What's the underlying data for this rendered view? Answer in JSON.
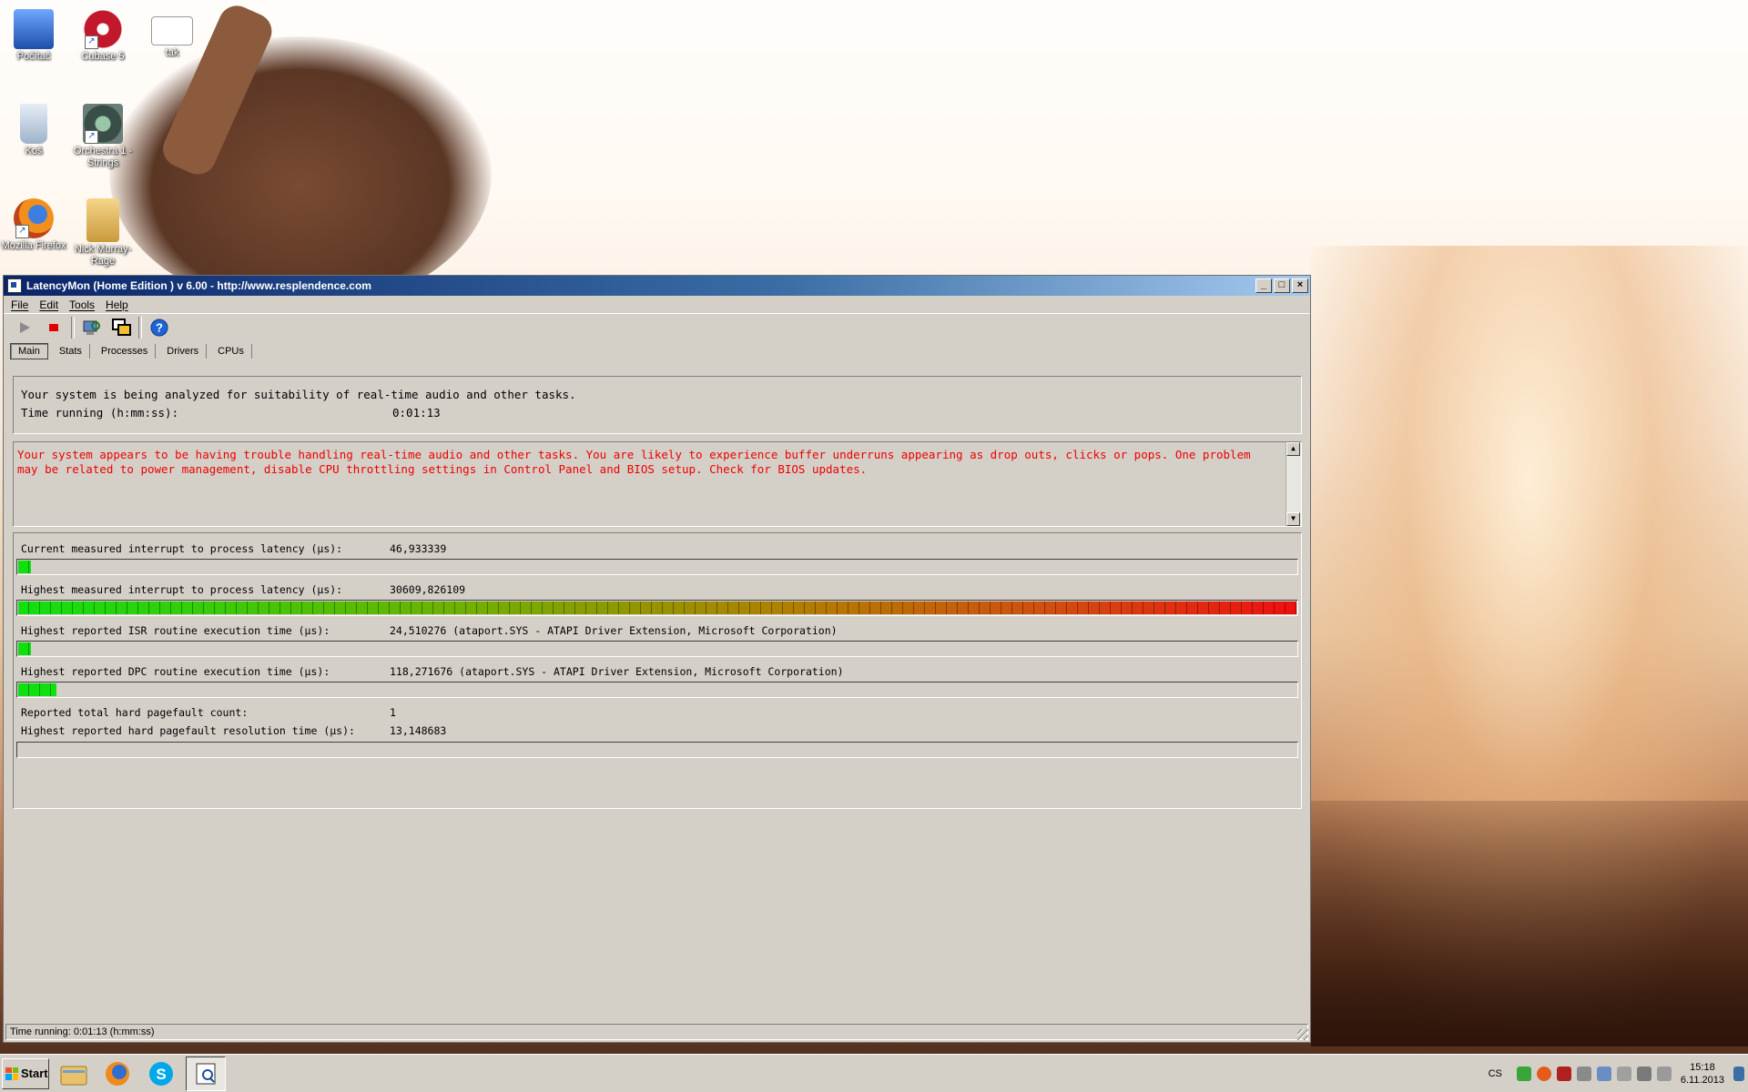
{
  "desktop": {
    "icons": [
      {
        "name": "Počítač"
      },
      {
        "name": "Cubase 5"
      },
      {
        "name": "tak"
      },
      {
        "name": "Koš"
      },
      {
        "name": "Orchestra 1 - Strings"
      },
      {
        "name": "Mozilla Firefox"
      },
      {
        "name": "Nick Murray-Rage"
      }
    ]
  },
  "window": {
    "title": "LatencyMon  (Home Edition )  v 6.00 - http://www.resplendence.com",
    "menu": [
      "File",
      "Edit",
      "Tools",
      "Help"
    ],
    "tabs": [
      "Main",
      "Stats",
      "Processes",
      "Drivers",
      "CPUs"
    ],
    "summary": {
      "line1": "Your system is being analyzed for suitability of real-time audio and other tasks.",
      "time_label": "Time running (h:mm:ss):",
      "time_value": "0:01:13"
    },
    "verdict": "Your system appears to be having trouble handling real-time audio and other tasks. You are likely to experience buffer underruns appearing as drop outs, clicks or pops. One problem may be related to power management, disable CPU throttling settings in Control Panel and BIOS setup. Check for BIOS updates.",
    "metrics": {
      "current_latency": {
        "label": "Current measured interrupt to process latency (µs):",
        "value": "46,933339",
        "level": 0.01
      },
      "highest_latency": {
        "label": "Highest measured interrupt to process latency (µs):",
        "value": "30609,826109",
        "level": 1.0
      },
      "isr": {
        "label": "Highest reported ISR routine execution time (µs):",
        "value": "24,510276  (ataport.SYS - ATAPI Driver Extension, Microsoft Corporation)",
        "level": 0.01
      },
      "dpc": {
        "label": "Highest reported DPC routine execution time (µs):",
        "value": "118,271676  (ataport.SYS - ATAPI Driver Extension, Microsoft Corporation)",
        "level": 0.03
      },
      "pagefault_count": {
        "label": "Reported total hard pagefault count:",
        "value": "1"
      },
      "pagefault_time": {
        "label": "Highest reported hard pagefault resolution time (µs):",
        "value": "13,148683",
        "level": 0.0
      }
    },
    "status_bar": "Time running: 0:01:13  (h:mm:ss)"
  },
  "taskbar": {
    "start_label": "Start",
    "apps": [
      "explorer-icon",
      "firefox-icon",
      "skype-icon",
      "latencymon-icon"
    ],
    "language": "CS",
    "time": "15:18",
    "date": "6.11.2013"
  },
  "colors": {
    "verdict_text": "#ee0000",
    "bar_green": "#10e010",
    "bar_red": "#ee1010"
  }
}
